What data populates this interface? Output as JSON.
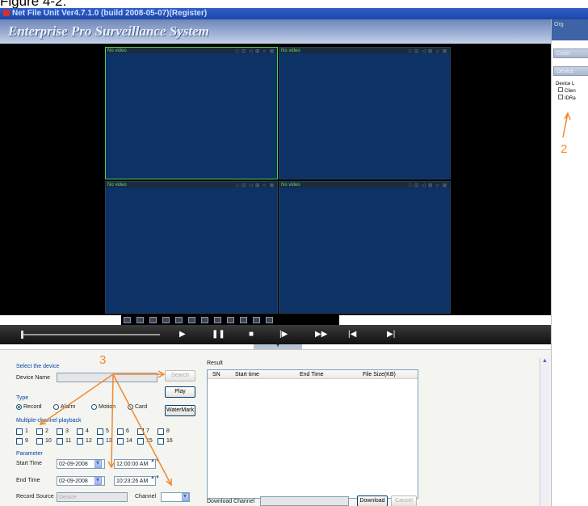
{
  "caption": "Figure 4-2:",
  "window": {
    "title": "Net File Unit  Ver4.7.1.0 (build 2008-05-07)(Register)"
  },
  "banner": {
    "brand": "Enterprise Pro Surveillance System"
  },
  "panes": [
    {
      "label": "No video",
      "tools": "□ ⊡ ◁ ⊞ ☼ ⊠",
      "selected": true
    },
    {
      "label": "No video",
      "tools": "□ ⊡ ◁ ⊞ ☼ ⊠",
      "selected": false
    },
    {
      "label": "No video",
      "tools": "□ ⊡ ◁ ⊞ ☼ ⊠",
      "selected": false
    },
    {
      "label": "No video",
      "tools": "□ ⊡ ◁ ⊞ ☼ ⊠",
      "selected": false
    }
  ],
  "playback_controls": [
    "▶",
    "❚❚",
    "■",
    "|▶",
    "▶▶",
    "|◀",
    "▶|"
  ],
  "right_panel": {
    "top_label": "Org",
    "buttons": [
      "Color",
      "Device"
    ],
    "tree": [
      "Device L",
      "Clien",
      "IDRa"
    ]
  },
  "annotations": {
    "a2": "2",
    "a3": "3"
  },
  "search": {
    "select_device": "Select the device",
    "device_name_label": "Device Name",
    "device_name_value": "",
    "search_btn": "Search",
    "play_btn": "Play",
    "watermark_btn": "WaterMark",
    "type_label": "Type",
    "types": [
      "Record",
      "Alarm",
      "Motion",
      "Card"
    ],
    "multi_label": "Multiple-channel playback",
    "channels_row1": [
      "1",
      "2",
      "3",
      "4",
      "5",
      "6",
      "7",
      "8"
    ],
    "channels_row2": [
      "9",
      "10",
      "11",
      "12",
      "13",
      "14",
      "15",
      "16"
    ],
    "parameter_label": "Parameter",
    "start_label": "Start Time",
    "start_date": "02-09-2008",
    "start_time": "12:00:00 AM",
    "end_label": "End Time",
    "end_date": "02-09-2008",
    "end_time": "10:23:26 AM",
    "source_label": "Record Source",
    "source_value": "Device",
    "channel_label": "Channel",
    "channel_value": ""
  },
  "result": {
    "title": "Result",
    "columns": [
      "SN",
      "Start time",
      "End Time",
      "File Size(KB)"
    ],
    "download_channel_label": "Download Channel",
    "download_btn": "Download",
    "cancel_btn": "Cancel"
  }
}
